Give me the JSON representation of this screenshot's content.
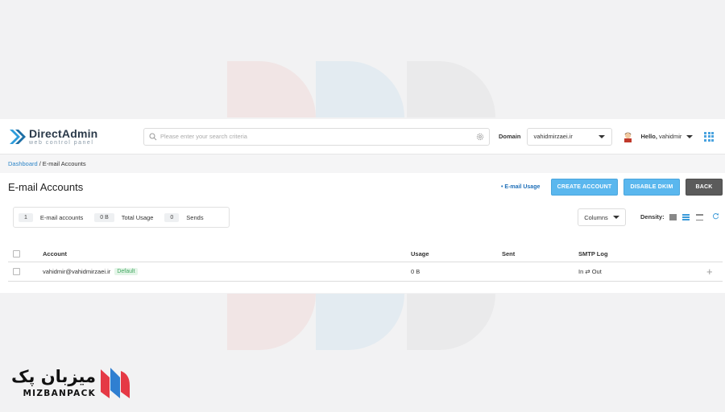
{
  "app": {
    "logo_name": "DirectAdmin",
    "logo_tagline": "web control panel"
  },
  "header": {
    "search_placeholder": "Please enter your search criteria",
    "domain_label": "Domain",
    "domain_value": "vahidmirzaei.ir",
    "hello_prefix": "Hello,",
    "username": "vahidmir"
  },
  "breadcrumb": {
    "root": "Dashboard",
    "separator": "/",
    "current": "E-mail Accounts"
  },
  "page": {
    "title": "E-mail Accounts",
    "usage_link": "• E-mail Usage",
    "buttons": {
      "create": "CREATE ACCOUNT",
      "dkim": "DISABLE DKIM",
      "back": "BACK"
    }
  },
  "stats": [
    {
      "value": "1",
      "label": "E-mail accounts"
    },
    {
      "value": "0 B",
      "label": "Total Usage"
    },
    {
      "value": "0",
      "label": "Sends"
    }
  ],
  "toolbar": {
    "columns_label": "Columns",
    "density_label": "Density:"
  },
  "table": {
    "headers": {
      "account": "Account",
      "usage": "Usage",
      "sent": "Sent",
      "smtp": "SMTP Log"
    },
    "rows": [
      {
        "account": "vahidmir@vahidmirzaei.ir",
        "badge": "Default",
        "usage": "0 B",
        "sent": "",
        "smtp": "In ⇄ Out"
      }
    ]
  },
  "brand": {
    "name_fa": "میزبان پک",
    "name_en": "MIZBANPACK"
  },
  "colors": {
    "accent": "#5ab7ee",
    "link": "#2f86c8",
    "back_button": "#5b5b5b",
    "badge_text": "#43a862"
  }
}
